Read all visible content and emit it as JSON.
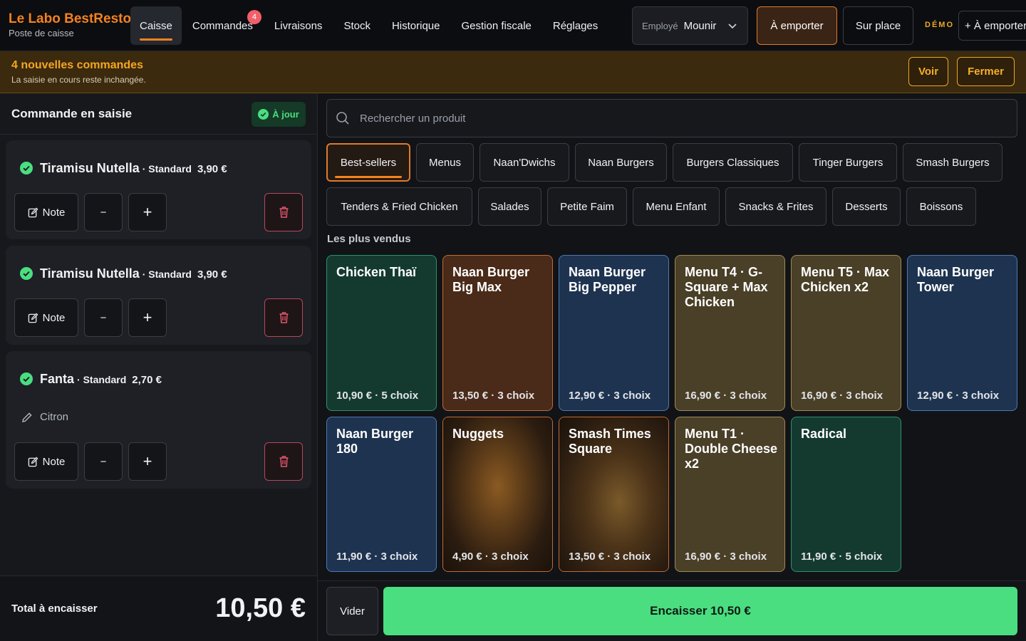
{
  "brand": {
    "name": "Le Labo BestResto",
    "subtitle": "Poste de caisse"
  },
  "nav": [
    {
      "label": "Caisse"
    },
    {
      "label": "Commandes",
      "badge": "4"
    },
    {
      "label": "Livraisons"
    },
    {
      "label": "Stock"
    },
    {
      "label": "Historique"
    },
    {
      "label": "Gestion fiscale"
    },
    {
      "label": "Réglages"
    }
  ],
  "employee": {
    "label": "Employé",
    "name": "Mounir"
  },
  "mode_buttons": {
    "emporter": "À emporter",
    "sur_place": "Sur place"
  },
  "demo_label": "DÉMO",
  "add_button": "+ À emporter",
  "banner": {
    "title": "4 nouvelles commandes",
    "subtitle": "La saisie en cours reste inchangée.",
    "voir": "Voir",
    "fermer": "Fermer"
  },
  "order": {
    "title": "Commande en saisie",
    "status": "À jour",
    "note_label": "Note",
    "minus": "−",
    "plus": "+",
    "items": [
      {
        "name": "Tiramisu Nutella",
        "variant": "· Standard",
        "price": "3,90 €"
      },
      {
        "name": "Tiramisu Nutella",
        "variant": "· Standard",
        "price": "3,90 €"
      },
      {
        "name": "Fanta",
        "variant": "· Standard",
        "price": "2,70 €",
        "option": "Citron"
      }
    ],
    "total_label": "Total à encaisser",
    "total_value": "10,50 €"
  },
  "search": {
    "placeholder": "Rechercher un produit"
  },
  "categories": [
    "Best-sellers",
    "Menus",
    "Naan'Dwichs",
    "Naan Burgers",
    "Burgers Classiques",
    "Tinger Burgers",
    "Smash Burgers",
    "Tenders & Fried Chicken",
    "Salades",
    "Petite Faim",
    "Menu Enfant",
    "Snacks & Frites",
    "Desserts",
    "Boissons"
  ],
  "active_category": "Best-sellers",
  "section_label": "Les plus vendus",
  "products": [
    {
      "name": "Chicken Thaï",
      "meta": "10,90 € · 5 choix",
      "color": "#143a30",
      "border": "#2f8f6a"
    },
    {
      "name": "Naan Burger Big Max",
      "meta": "13,50 € · 3 choix",
      "color": "#4a2a18",
      "border": "#c26a33"
    },
    {
      "name": "Naan Burger Big Pepper",
      "meta": "12,90 € · 3 choix",
      "color": "#1e3350",
      "border": "#4c79b4"
    },
    {
      "name": "Menu T4 · G-Square + Max Chicken",
      "meta": "16,90 € · 3 choix",
      "color": "#4a3f27",
      "border": "#a08a52"
    },
    {
      "name": "Menu T5 · Max Chicken x2",
      "meta": "16,90 € · 3 choix",
      "color": "#4a3f27",
      "border": "#a08a52"
    },
    {
      "name": "Naan Burger Tower",
      "meta": "12,90 € · 3 choix",
      "color": "#1e3350",
      "border": "#4c79b4"
    },
    {
      "name": "Naan Burger 180",
      "meta": "11,90 € · 3 choix",
      "color": "#1e3350",
      "border": "#4c79b4"
    },
    {
      "name": "Nuggets",
      "meta": "4,90 € · 3 choix",
      "color": "#3d2a18",
      "border": "#c26a33"
    },
    {
      "name": "Smash Times Square",
      "meta": "13,50 € · 3 choix",
      "color": "#2f2418",
      "border": "#c26a33"
    },
    {
      "name": "Menu T1 · Double Cheese x2",
      "meta": "16,90 € · 3 choix",
      "color": "#4a3f27",
      "border": "#a08a52"
    },
    {
      "name": "Radical",
      "meta": "11,90 € · 5 choix",
      "color": "#143a30",
      "border": "#2f8f6a"
    }
  ],
  "footer": {
    "vider": "Vider",
    "encaisser": "Encaisser 10,50 €"
  }
}
